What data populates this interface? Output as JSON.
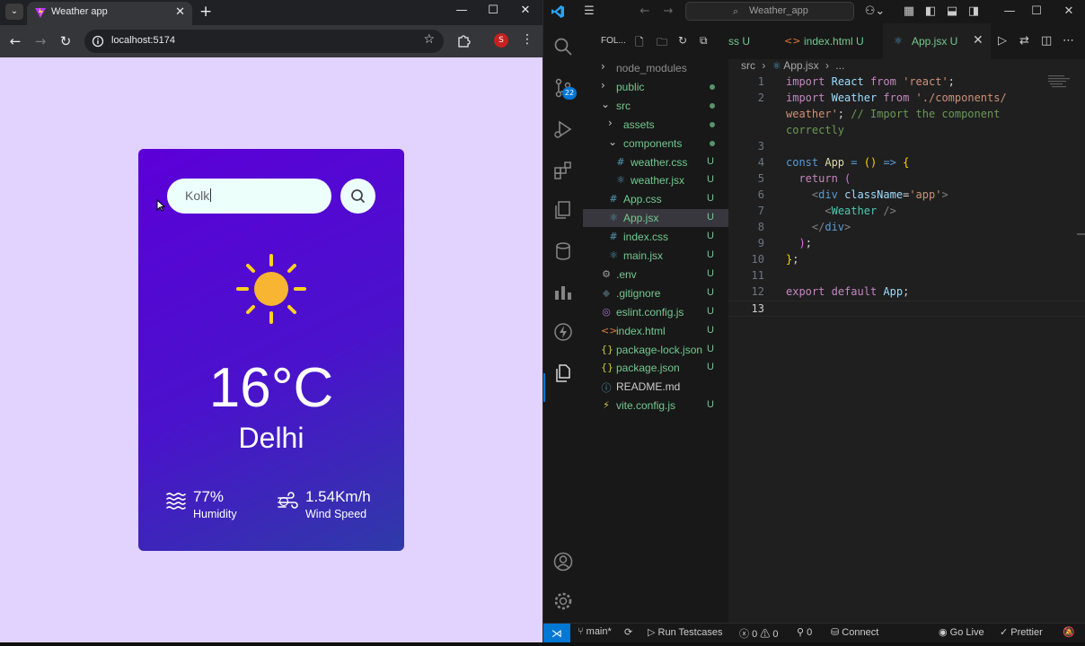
{
  "browser": {
    "tab_title": "Weather app",
    "url": "localhost:5174",
    "profile_initial": "S",
    "new_tab": "+",
    "tab_close": "✕"
  },
  "weather": {
    "search_value": "Kolk",
    "temperature": "16°C",
    "city": "Delhi",
    "humidity_value": "77%",
    "humidity_label": "Humidity",
    "wind_value": "1.54Km/h",
    "wind_label": "Wind Speed"
  },
  "vscode": {
    "search_text": "Weather_app",
    "scm_badge": "22",
    "explorer_title": "FOL...",
    "tree": [
      {
        "name": "node_modules",
        "type": "folder",
        "indent": 0,
        "status": "",
        "dim": true
      },
      {
        "name": "public",
        "type": "folder",
        "indent": 0,
        "status": "dot"
      },
      {
        "name": "src",
        "type": "folder-open",
        "indent": 0,
        "status": "dot"
      },
      {
        "name": "assets",
        "type": "folder",
        "indent": 1,
        "status": "dot"
      },
      {
        "name": "components",
        "type": "folder-open",
        "indent": 1,
        "status": "dot"
      },
      {
        "name": "weather.css",
        "type": "css",
        "indent": 2,
        "status": "U"
      },
      {
        "name": "weather.jsx",
        "type": "jsx",
        "indent": 2,
        "status": "U"
      },
      {
        "name": "App.css",
        "type": "css",
        "indent": 1,
        "status": "U"
      },
      {
        "name": "App.jsx",
        "type": "jsx",
        "indent": 1,
        "status": "U",
        "selected": true
      },
      {
        "name": "index.css",
        "type": "css",
        "indent": 1,
        "status": "U"
      },
      {
        "name": "main.jsx",
        "type": "jsx",
        "indent": 1,
        "status": "U"
      },
      {
        "name": ".env",
        "type": "gear",
        "indent": 0,
        "status": "U"
      },
      {
        "name": ".gitignore",
        "type": "diamond",
        "indent": 0,
        "status": "U"
      },
      {
        "name": "eslint.config.js",
        "type": "eslint",
        "indent": 0,
        "status": "U"
      },
      {
        "name": "index.html",
        "type": "html",
        "indent": 0,
        "status": "U"
      },
      {
        "name": "package-lock.json",
        "type": "json",
        "indent": 0,
        "status": "U"
      },
      {
        "name": "package.json",
        "type": "json",
        "indent": 0,
        "status": "U"
      },
      {
        "name": "README.md",
        "type": "info",
        "indent": 0,
        "status": ""
      },
      {
        "name": "vite.config.js",
        "type": "vite",
        "indent": 0,
        "status": "U"
      }
    ],
    "tabs": [
      {
        "label": "ss U",
        "partial": true
      },
      {
        "label": "index.html U",
        "icon": "html"
      },
      {
        "label": "App.jsx U",
        "icon": "jsx",
        "active": true
      }
    ],
    "tab_close": "✕",
    "breadcrumb": [
      "src",
      "App.jsx",
      "..."
    ],
    "code": [
      {
        "n": "1",
        "html": "<span class='kw'>import</span> <span class='id'>React</span> <span class='kw'>from</span> <span class='str'>'react'</span>;"
      },
      {
        "n": "2",
        "html": "<span class='kw'>import</span> <span class='id'>Weather</span> <span class='kw'>from</span> <span class='str'>'./components/</span>"
      },
      {
        "n": "",
        "html": "<span class='str'>weather'</span>; <span class='cmt'>// Import the component</span>"
      },
      {
        "n": "",
        "html": "<span class='cmt'>correctly</span>"
      },
      {
        "n": "3",
        "html": ""
      },
      {
        "n": "4",
        "html": "<span class='kw2'>const</span> <span class='fn'>App</span> <span class='kw2'>=</span> <span class='br'>()</span> <span class='kw2'>=&gt;</span> <span class='br'>{</span>"
      },
      {
        "n": "5",
        "html": "  <span class='kw'>return</span> <span class='br2'>(</span>"
      },
      {
        "n": "6",
        "html": "    <span class='punc'>&lt;</span><span class='tag'>div</span> <span class='attr'>className</span>=<span class='str'>'app'</span><span class='punc'>&gt;</span>"
      },
      {
        "n": "7",
        "html": "      <span class='punc'>&lt;</span><span class='cls'>Weather</span> <span class='punc'>/&gt;</span>"
      },
      {
        "n": "8",
        "html": "    <span class='punc'>&lt;/</span><span class='tag'>div</span><span class='punc'>&gt;</span>"
      },
      {
        "n": "9",
        "html": "  <span class='br2'>)</span>;"
      },
      {
        "n": "10",
        "html": "<span class='br'>}</span>;"
      },
      {
        "n": "11",
        "html": ""
      },
      {
        "n": "12",
        "html": "<span class='kw'>export</span> <span class='kw'>default</span> <span class='id'>App</span>;"
      },
      {
        "n": "13",
        "html": "",
        "current": true
      }
    ],
    "status": {
      "branch": "main*",
      "run": "Run Testcases",
      "errors": "0",
      "warnings": "0",
      "ports": "0",
      "connect": "Connect",
      "golive": "Go Live",
      "prettier": "Prettier"
    }
  },
  "colors": {
    "viewport_bg": "#e2d2fe",
    "card_gradient_start": "#5c00d8",
    "card_gradient_end": "#2f3aa8",
    "sun": "#f7b531",
    "sun_ray": "#ffd21f",
    "vscode_accent": "#0078d4",
    "git_untracked": "#73c991"
  },
  "icons": [
    "weather-app-favicon",
    "info-icon",
    "star-icon",
    "extensions-icon",
    "search-icon",
    "sun-icon",
    "humidity-icon",
    "wind-icon",
    "vscode-logo-icon",
    "explorer-icon",
    "source-control-icon",
    "run-debug-icon",
    "extensions-icon",
    "remote-explorer-icon",
    "database-icon",
    "chart-icon",
    "lightning-icon",
    "copilot-icon",
    "account-icon",
    "settings-gear-icon"
  ]
}
